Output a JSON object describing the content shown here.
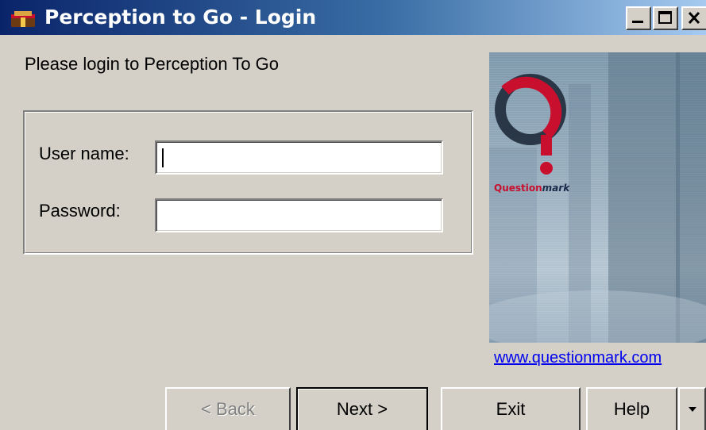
{
  "window": {
    "title": "Perception to Go - Login"
  },
  "title_controls": {
    "minimize_icon": "minimize-icon",
    "maximize_icon": "maximize-icon",
    "close_icon": "close-icon"
  },
  "login": {
    "prompt": "Please login to Perception To Go",
    "username_label": "User name:",
    "username_value": "",
    "password_label": "Password:",
    "password_value": ""
  },
  "brand": {
    "name_part1": "Question",
    "name_part2": "mark",
    "link": "www.questionmark.com",
    "logo_color": "#c8102e"
  },
  "buttons": {
    "back": "< Back",
    "next": "Next >",
    "exit": "Exit",
    "help": "Help"
  },
  "colors": {
    "titlebar_start": "#0a246a",
    "titlebar_end": "#a6caf0",
    "dialog_bg": "#d4d0c8",
    "link": "#0000ee"
  }
}
